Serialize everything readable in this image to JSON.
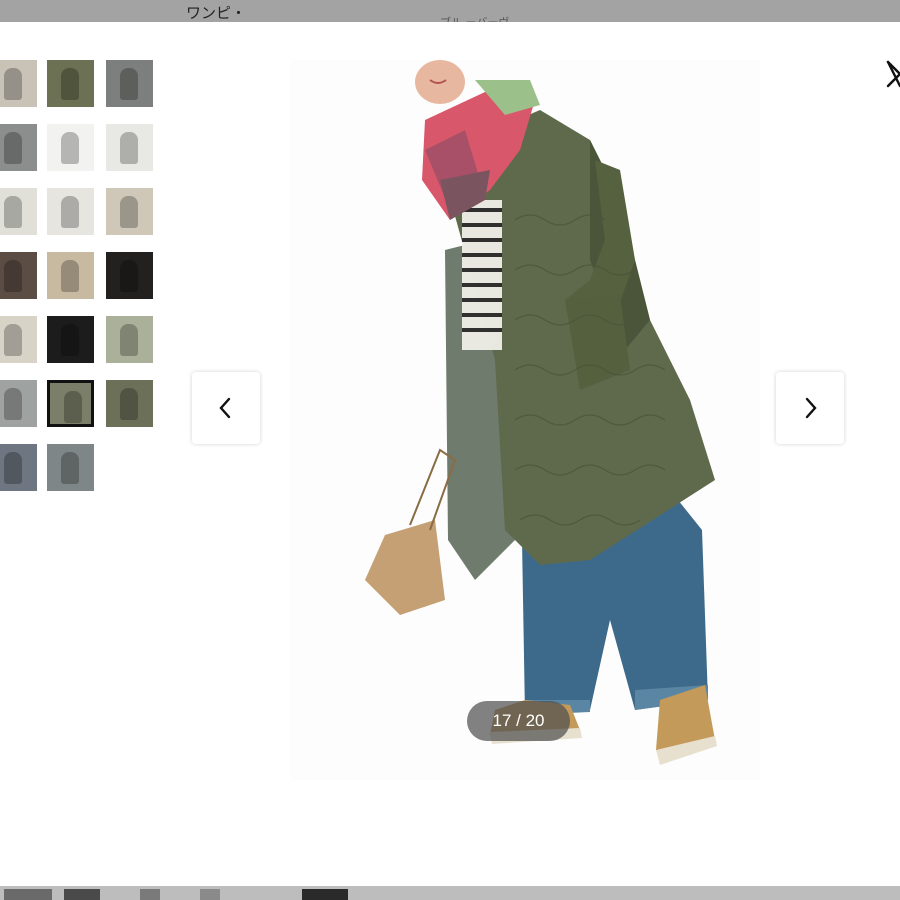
{
  "background": {
    "top_text": "ワンピ・",
    "top_faded": "ブル            ーバーヴ          "
  },
  "modal": {
    "close_icon": "close-icon",
    "prev_icon": "chevron-left-icon",
    "next_icon": "chevron-right-icon",
    "counter": "17 / 20",
    "current_index": 17,
    "total": 20
  },
  "thumbnails": [
    {
      "label": "thumb-1",
      "color": "#c9c2b6"
    },
    {
      "label": "thumb-2",
      "color": "#6b7152"
    },
    {
      "label": "thumb-3",
      "color": "#7c7f7d"
    },
    {
      "label": "thumb-4",
      "color": "#8b8e8d"
    },
    {
      "label": "thumb-5",
      "color": "#f2f2f0"
    },
    {
      "label": "thumb-6",
      "color": "#e8e8e4"
    },
    {
      "label": "thumb-7",
      "color": "#e1e0d8"
    },
    {
      "label": "thumb-8",
      "color": "#e6e5df"
    },
    {
      "label": "thumb-9",
      "color": "#cfc8b8"
    },
    {
      "label": "thumb-10",
      "color": "#5b4d44"
    },
    {
      "label": "thumb-11",
      "color": "#c8b9a1"
    },
    {
      "label": "thumb-12",
      "color": "#23211f"
    },
    {
      "label": "thumb-13",
      "color": "#d8d3c7"
    },
    {
      "label": "thumb-14",
      "color": "#1c1c1c"
    },
    {
      "label": "thumb-15",
      "color": "#aab09a"
    },
    {
      "label": "thumb-16",
      "color": "#9ea2a1"
    },
    {
      "label": "thumb-17",
      "color": "#7b7e69",
      "active": true
    },
    {
      "label": "thumb-18",
      "color": "#6d7059"
    },
    {
      "label": "thumb-19",
      "color": "#6e7681"
    },
    {
      "label": "thumb-20",
      "color": "#7f8687"
    }
  ],
  "colors": {
    "coat": "#5f6a4c",
    "coat_dark": "#4b553a",
    "jeans": "#3d6a8a",
    "scarf_pink": "#d9576a",
    "scarf_green": "#9cc08a",
    "bag": "#c4a074",
    "shoe": "#c39a5a",
    "counter_bg": "#505050"
  }
}
